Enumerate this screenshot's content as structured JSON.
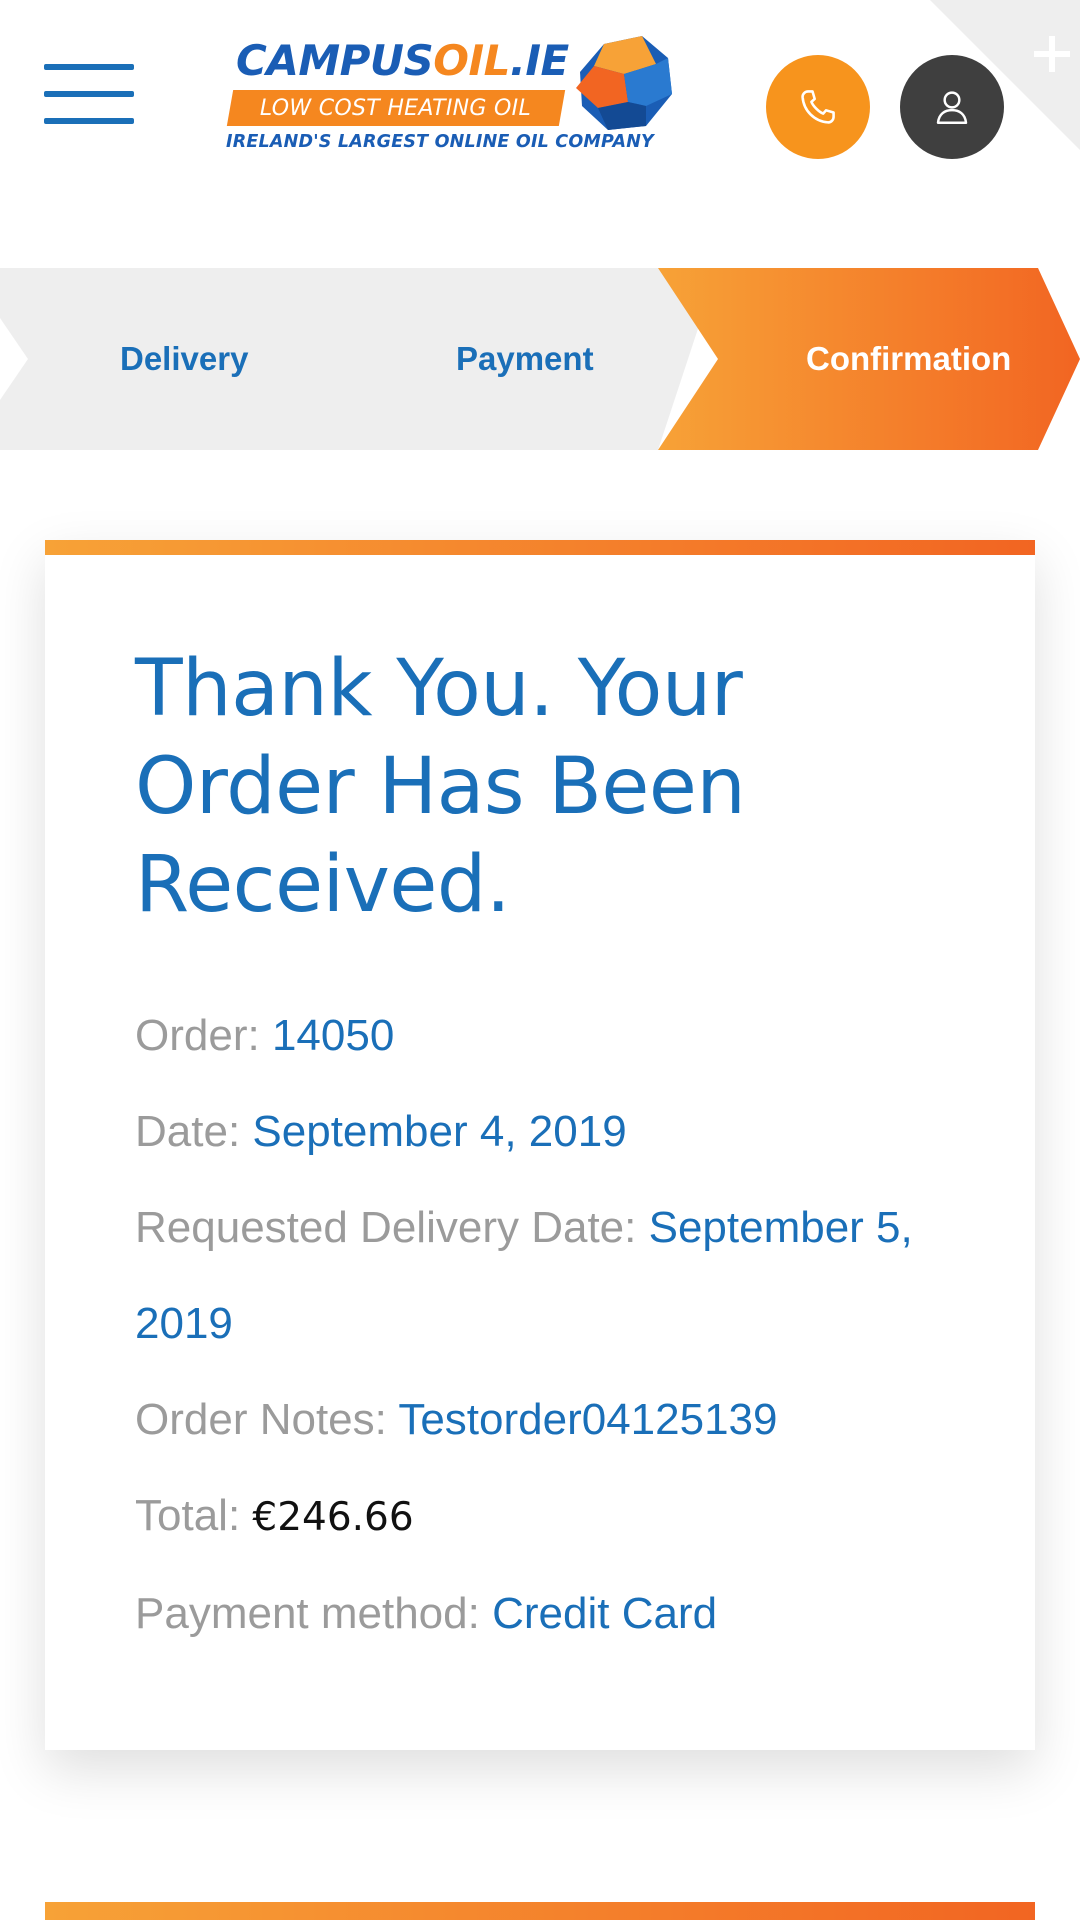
{
  "header": {
    "logo": {
      "brand_part1": "CAMPUS",
      "brand_part2": "OIL",
      "brand_part3": ".IE",
      "tagline": "LOW COST HEATING OIL",
      "subline": "IRELAND'S LARGEST ONLINE OIL COMPANY"
    },
    "icons": {
      "menu": "hamburger-menu-icon",
      "phone": "phone-icon",
      "account": "user-icon",
      "corner": "plus-icon"
    }
  },
  "steps": {
    "items": [
      {
        "label": "Delivery",
        "state": "completed"
      },
      {
        "label": "Payment",
        "state": "completed"
      },
      {
        "label": "Confirmation",
        "state": "active"
      }
    ]
  },
  "confirmation": {
    "title": "Thank You. Your Order Has Been Received.",
    "order_label": "Order:",
    "order_value": "14050",
    "date_label": "Date:",
    "date_value": "September 4, 2019",
    "delivery_label": "Requested Delivery Date:",
    "delivery_value": "September 5, 2019",
    "notes_label": "Order Notes:",
    "notes_value": "Testorder04125139",
    "total_label": "Total:",
    "total_value": "€246.66",
    "payment_label": "Payment method:",
    "payment_value": "Credit Card"
  },
  "colors": {
    "brand_blue": "#1a6fb8",
    "brand_orange": "#f7941d",
    "gradient_start": "#f7a237",
    "gradient_end": "#f26522",
    "label_grey": "#9b9b9b",
    "account_dark": "#3f3f3f"
  }
}
